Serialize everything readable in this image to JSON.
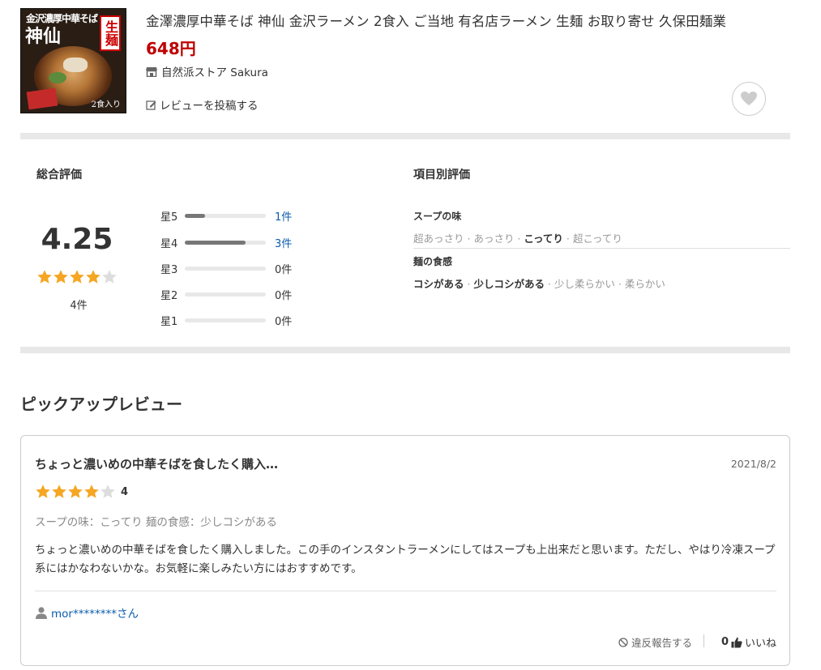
{
  "product": {
    "image_label_top": "金沢濃厚中華そば",
    "image_label_big": "神仙",
    "image_label_nama": "生麺",
    "image_label_count": "2食入り",
    "title": "金澤濃厚中華そば 神仙 金沢ラーメン 2食入 ご当地 有名店ラーメン 生麺 お取り寄せ 久保田麺業",
    "price": "648円",
    "store": "自然派ストア Sakura",
    "post_review": "レビューを投稿する"
  },
  "summary": {
    "title": "総合評価",
    "average": "4.25",
    "average_value": 4.25,
    "total": "4件",
    "distribution": [
      {
        "label": "星5",
        "count": "1件",
        "fraction": 0.25,
        "link": true
      },
      {
        "label": "星4",
        "count": "3件",
        "fraction": 0.75,
        "link": true
      },
      {
        "label": "星3",
        "count": "0件",
        "fraction": 0,
        "link": false
      },
      {
        "label": "星2",
        "count": "0件",
        "fraction": 0,
        "link": false
      },
      {
        "label": "星1",
        "count": "0件",
        "fraction": 0,
        "link": false
      }
    ]
  },
  "items": {
    "title": "項目別評価",
    "list": [
      {
        "name": "スープの味",
        "options": [
          "超あっさり",
          "あっさり",
          "こってり",
          "超こってり"
        ],
        "selected": [
          2
        ]
      },
      {
        "name": "麺の食感",
        "options": [
          "コシがある",
          "少しコシがある",
          "少し柔らかい",
          "柔らかい"
        ],
        "selected": [
          0,
          1
        ]
      }
    ]
  },
  "pickup": {
    "title": "ピックアップレビュー",
    "review": {
      "title": "ちょっと濃いめの中華そばを食したく購入…",
      "date": "2021/8/2",
      "rating": 4,
      "rating_label": "4",
      "attributes": "スープの味：こってり 麺の食感：少しコシがある",
      "body": "ちょっと濃いめの中華そばを食したく購入しました。この手のインスタントラーメンにしてはスープも上出来だと思います。ただし、やはり冷凍スープ系にはかなわないかな。お気軽に楽しみたい方にはおすすめです。",
      "user": "mor********さん",
      "report": "違反報告する",
      "like_count": "0",
      "like_label": "いいね"
    }
  },
  "colors": {
    "star": "#f5a623",
    "star_empty": "#dddddd",
    "price": "#bf0000",
    "link": "#0b5cad"
  },
  "icons": [
    "store-icon",
    "edit-icon",
    "heart-icon",
    "star-icon",
    "user-icon",
    "prohibit-icon",
    "thumbs-up-icon"
  ]
}
